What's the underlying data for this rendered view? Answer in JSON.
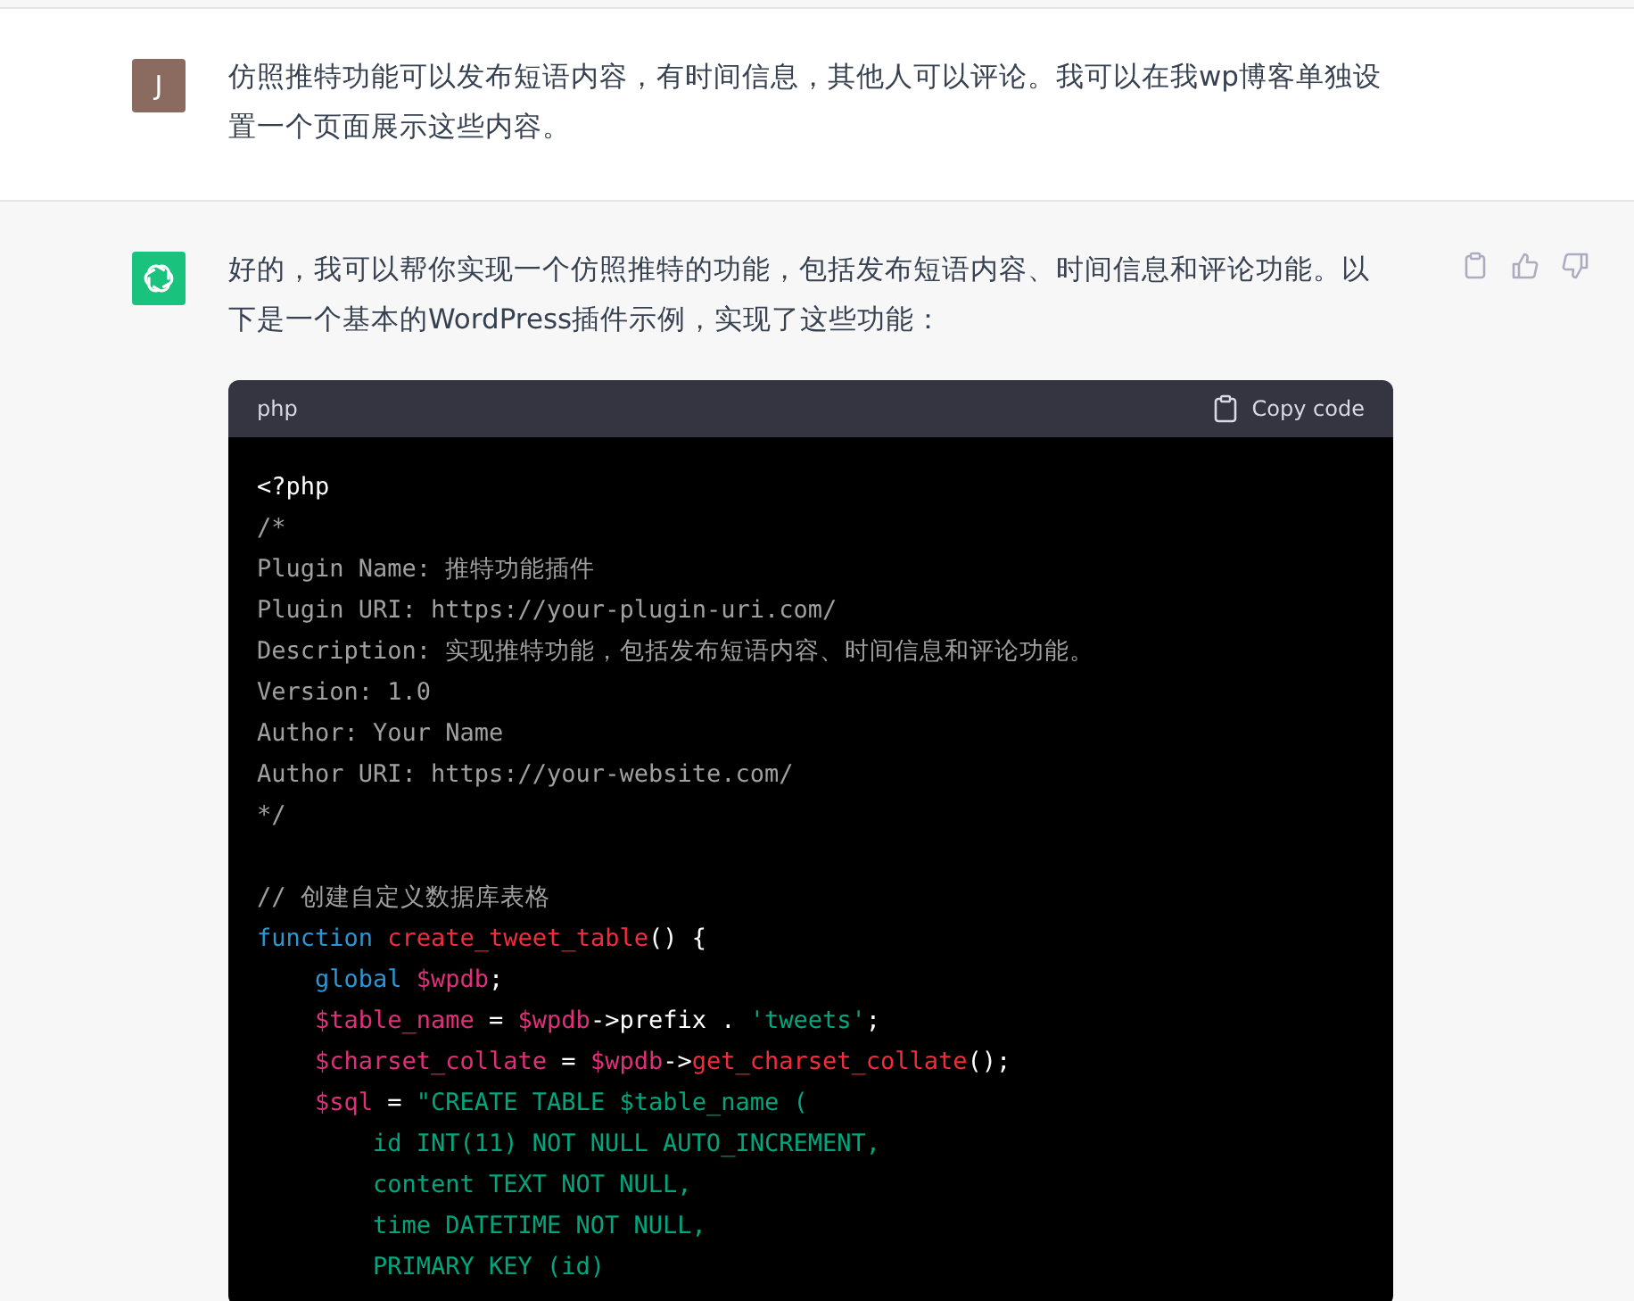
{
  "user_message": {
    "avatar_letter": "J",
    "text": "仿照推特功能可以发布短语内容，有时间信息，其他人可以评论。我可以在我wp博客单独设置一个页面展示这些内容。"
  },
  "assistant_message": {
    "text": "好的，我可以帮你实现一个仿照推特的功能，包括发布短语内容、时间信息和评论功能。以下是一个基本的WordPress插件示例，实现了这些功能：",
    "code_block": {
      "language": "php",
      "copy_label": "Copy code",
      "lines": [
        {
          "kind": "code",
          "tokens": [
            {
              "kind": "text",
              "text": "<?php"
            }
          ]
        },
        {
          "kind": "code",
          "tokens": [
            {
              "kind": "comment",
              "text": "/*"
            }
          ]
        },
        {
          "kind": "code",
          "tokens": [
            {
              "kind": "comment",
              "text": "Plugin Name: 推特功能插件"
            }
          ]
        },
        {
          "kind": "code",
          "tokens": [
            {
              "kind": "comment",
              "text": "Plugin URI: https://your-plugin-uri.com/"
            }
          ]
        },
        {
          "kind": "code",
          "tokens": [
            {
              "kind": "comment",
              "text": "Description: 实现推特功能，包括发布短语内容、时间信息和评论功能。"
            }
          ]
        },
        {
          "kind": "code",
          "tokens": [
            {
              "kind": "comment",
              "text": "Version: 1.0"
            }
          ]
        },
        {
          "kind": "code",
          "tokens": [
            {
              "kind": "comment",
              "text": "Author: Your Name"
            }
          ]
        },
        {
          "kind": "code",
          "tokens": [
            {
              "kind": "comment",
              "text": "Author URI: https://your-website.com/"
            }
          ]
        },
        {
          "kind": "code",
          "tokens": [
            {
              "kind": "comment",
              "text": "*/"
            }
          ]
        },
        {
          "kind": "blank"
        },
        {
          "kind": "code",
          "tokens": [
            {
              "kind": "comment",
              "text": "// 创建自定义数据库表格"
            }
          ]
        },
        {
          "kind": "code",
          "tokens": [
            {
              "kind": "keyword",
              "text": "function "
            },
            {
              "kind": "title",
              "text": "create_tweet_table"
            },
            {
              "kind": "text",
              "text": "() {"
            }
          ],
          "children": [
            {
              "kind": "code",
              "tokens": [
                {
                  "kind": "keyword",
                  "text": "global "
                },
                {
                  "kind": "variable",
                  "text": "$wpdb"
                },
                {
                  "kind": "text",
                  "text": ";"
                }
              ]
            },
            {
              "kind": "code",
              "tokens": [
                {
                  "kind": "variable",
                  "text": "$table_name"
                },
                {
                  "kind": "text",
                  "text": " = "
                },
                {
                  "kind": "variable",
                  "text": "$wpdb"
                },
                {
                  "kind": "text",
                  "text": "->"
                },
                {
                  "kind": "property",
                  "text": "prefix"
                },
                {
                  "kind": "text",
                  "text": " . "
                },
                {
                  "kind": "string",
                  "text": "'tweets'"
                },
                {
                  "kind": "text",
                  "text": ";"
                }
              ]
            },
            {
              "kind": "code",
              "tokens": [
                {
                  "kind": "variable",
                  "text": "$charset_collate"
                },
                {
                  "kind": "text",
                  "text": " = "
                },
                {
                  "kind": "variable",
                  "text": "$wpdb"
                },
                {
                  "kind": "text",
                  "text": "->"
                },
                {
                  "kind": "title",
                  "text": "get_charset_collate"
                },
                {
                  "kind": "text",
                  "text": "();"
                }
              ]
            },
            {
              "kind": "code",
              "tokens": [
                {
                  "kind": "variable",
                  "text": "$sql"
                },
                {
                  "kind": "text",
                  "text": " = "
                },
                {
                  "kind": "string",
                  "text": "\"CREATE TABLE $table_name ("
                }
              ],
              "children": [
                {
                  "kind": "code",
                  "tokens": [
                    {
                      "kind": "string",
                      "text": "id INT(11) NOT NULL AUTO_INCREMENT,"
                    }
                  ]
                },
                {
                  "kind": "code",
                  "tokens": [
                    {
                      "kind": "string",
                      "text": "content TEXT NOT NULL,"
                    }
                  ]
                },
                {
                  "kind": "code",
                  "tokens": [
                    {
                      "kind": "string",
                      "text": "time DATETIME NOT NULL,"
                    }
                  ]
                },
                {
                  "kind": "code",
                  "tokens": [
                    {
                      "kind": "string",
                      "text": "PRIMARY KEY (id)"
                    }
                  ]
                }
              ]
            }
          ]
        }
      ]
    }
  }
}
